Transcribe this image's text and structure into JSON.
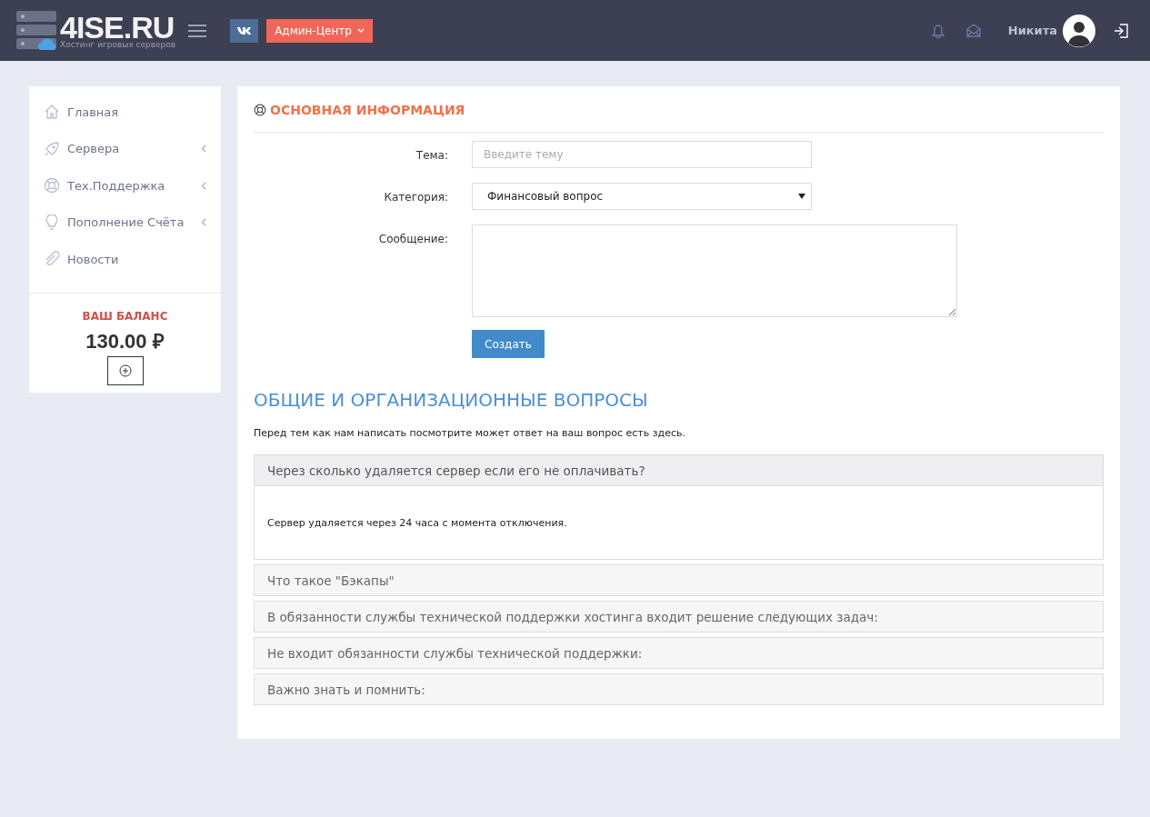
{
  "header": {
    "logo": "4ISE.RU",
    "tagline": "Хостинг игровых серверов",
    "admin_menu": "Админ-Центр",
    "user_name": "Никита"
  },
  "sidebar": {
    "items": [
      {
        "label": "Главная",
        "expandable": false
      },
      {
        "label": "Сервера",
        "expandable": true
      },
      {
        "label": "Тех.Поддержка",
        "expandable": true
      },
      {
        "label": "Пополнение Счёта",
        "expandable": true
      },
      {
        "label": "Новости",
        "expandable": false
      }
    ],
    "balance_label": "ВАШ БАЛАНС",
    "balance": "130.00 ₽"
  },
  "form": {
    "title": "ОСНОВНАЯ ИНФОРМАЦИЯ",
    "fields": [
      {
        "kind": "text",
        "label": "Тема:",
        "placeholder": "Введите тему"
      },
      {
        "kind": "select",
        "label": "Категория:",
        "value": "Финансовый вопрос"
      },
      {
        "kind": "textarea",
        "label": "Сообщение:"
      }
    ],
    "submit": "Создать"
  },
  "faq": {
    "title": "ОБЩИЕ И ОРГАНИЗАЦИОННЫЕ ВОПРОСЫ",
    "intro": "Перед тем как нам написать посмотрите может ответ на ваш вопрос есть здесь.",
    "items": [
      {
        "question": "Через сколько удаляется сервер если его не оплачивать?",
        "expanded": true,
        "answer": "Сервер удаляется через 24 часа с момента отключения."
      },
      {
        "question": "Что такое \"Бэкапы\"",
        "expanded": false
      },
      {
        "question": "В обязанности службы технической поддержки хостинга входит решение следующих задач:",
        "expanded": false
      },
      {
        "question": "Не входит обязанности службы технической поддержки:",
        "expanded": false
      },
      {
        "question": "Важно знать и помнить:",
        "expanded": false
      }
    ]
  }
}
